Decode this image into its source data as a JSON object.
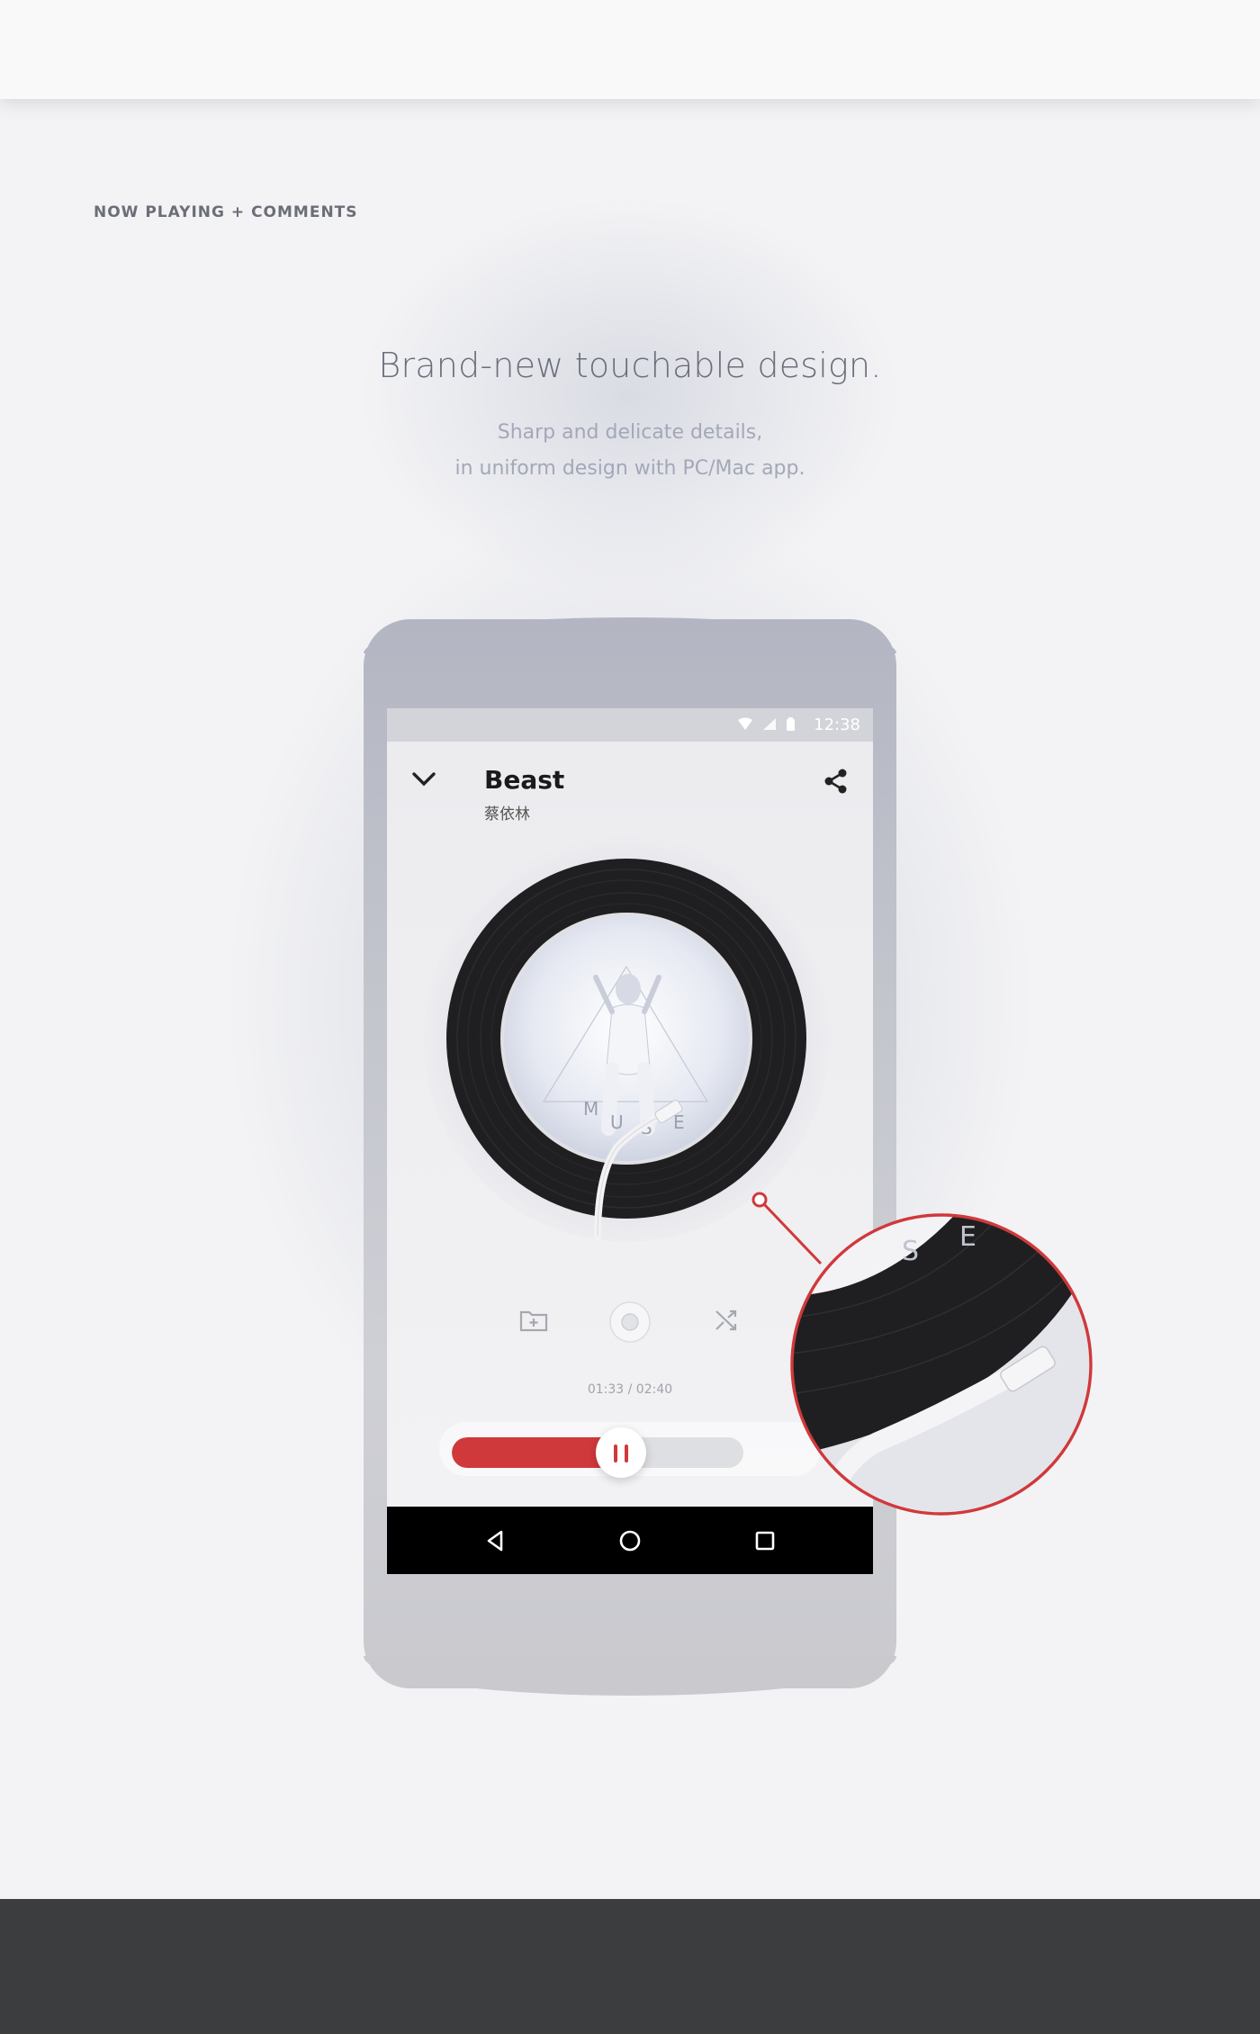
{
  "section": {
    "label": "NOW PLAYING + COMMENTS"
  },
  "hero": {
    "headline": "Brand-new touchable design.",
    "sub_line_1": "Sharp and delicate details,",
    "sub_line_2": "in uniform design with PC/Mac app."
  },
  "status_bar": {
    "time": "12:38"
  },
  "player": {
    "title": "Beast",
    "artist": "蔡依林",
    "album_art_letters": [
      "M",
      "U",
      "S",
      "E"
    ],
    "time_readout": "01:33 / 02:40",
    "progress_fraction": 0.58
  },
  "icons": {
    "back": "chevron-down-icon",
    "share": "share-icon",
    "add_to_playlist": "folder-add-icon",
    "shuffle": "shuffle-icon",
    "pause": "pause-icon",
    "nav_back": "nav-back-icon",
    "nav_home": "nav-home-icon",
    "nav_recent": "nav-recent-icon"
  },
  "colors": {
    "accent": "#d0393b",
    "vinyl": "#1f1f21",
    "footer": "#3c3d3e"
  }
}
